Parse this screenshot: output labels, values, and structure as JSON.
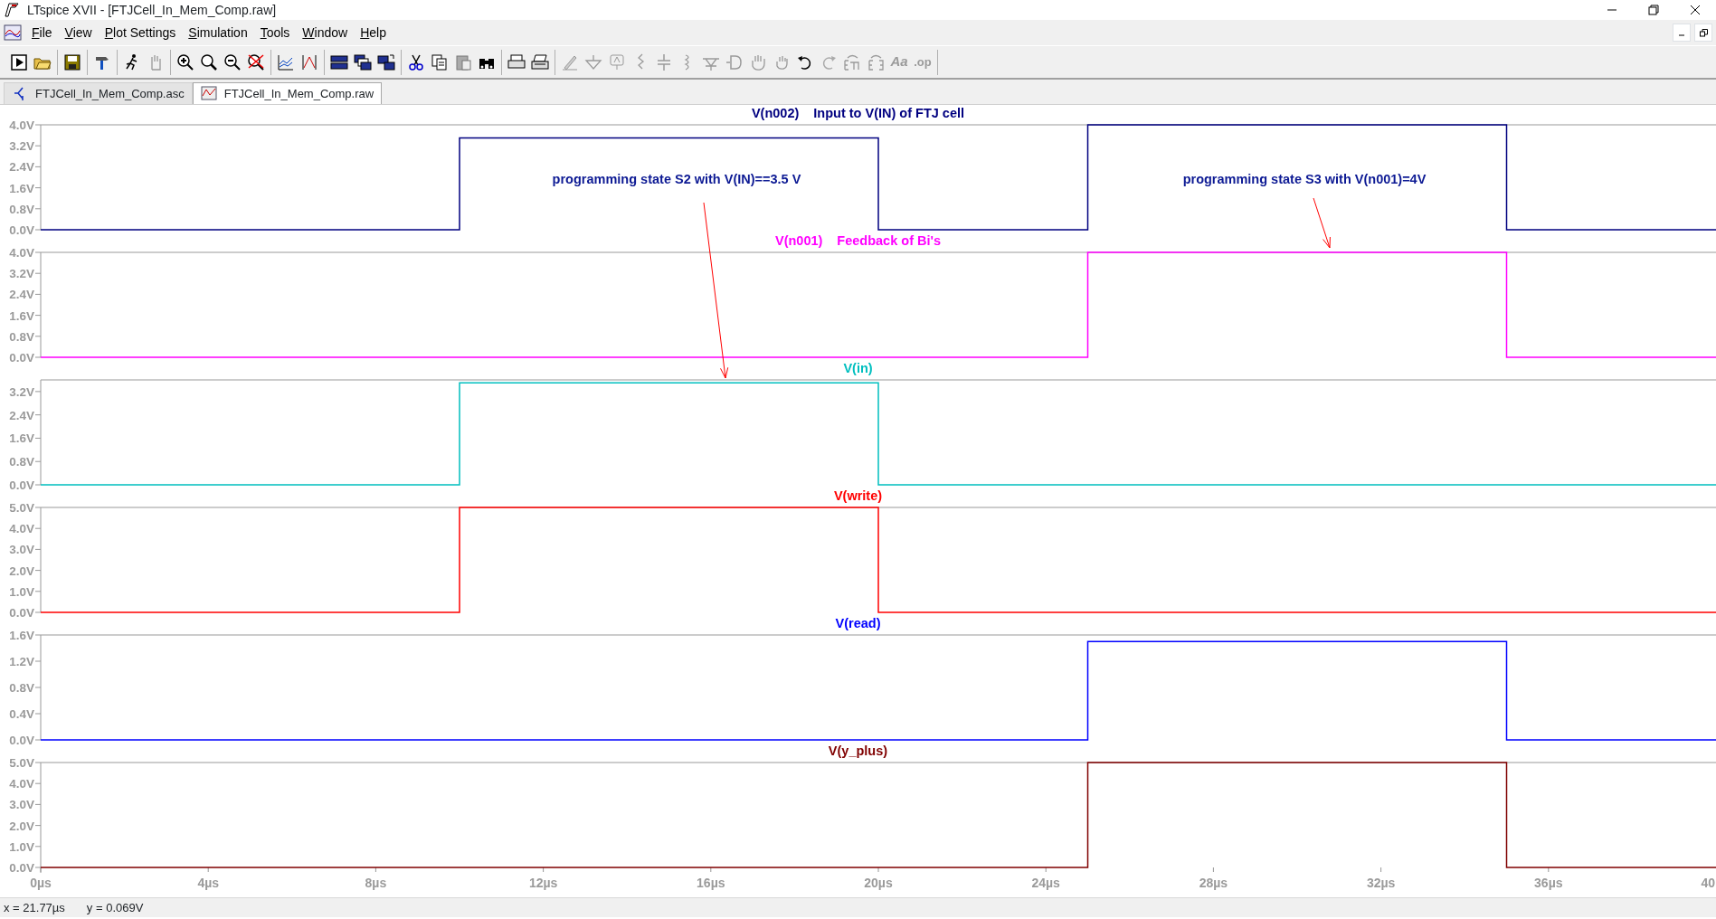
{
  "window": {
    "title": "LTspice XVII - [FTJCell_In_Mem_Comp.raw]"
  },
  "menu": [
    "File",
    "View",
    "Plot Settings",
    "Simulation",
    "Tools",
    "Window",
    "Help"
  ],
  "toolbar": {
    "text_buttons": [
      "Aa",
      ".op"
    ]
  },
  "tabs": [
    {
      "label": "FTJCell_In_Mem_Comp.asc",
      "kind": "schematic",
      "selected": false
    },
    {
      "label": "FTJCell_In_Mem_Comp.raw",
      "kind": "waveform",
      "selected": true
    }
  ],
  "panes": [
    {
      "description": "Input to V(IN) of FTJ cell",
      "chart_data": {
        "type": "line",
        "x": [
          0,
          10,
          10,
          20,
          20,
          25,
          25,
          35,
          35,
          40
        ],
        "xlim": [
          0,
          40
        ],
        "ylim": [
          0,
          4
        ],
        "series": [
          {
            "name": "V(n002)",
            "color": "#000080",
            "values": [
              0,
              0,
              3.5,
              3.5,
              0,
              0,
              4,
              4,
              0,
              0
            ]
          }
        ],
        "yticks": [
          {
            "value": 0,
            "label": "0.0V"
          },
          {
            "value": 0.8,
            "label": "0.8V"
          },
          {
            "value": 1.6,
            "label": "1.6V"
          },
          {
            "value": 2.4,
            "label": "2.4V"
          },
          {
            "value": 3.2,
            "label": "3.2V"
          },
          {
            "value": 4,
            "label": "4.0V"
          }
        ]
      }
    },
    {
      "description": "Feedback of Bi's",
      "chart_data": {
        "type": "line",
        "x": [
          0,
          10,
          10,
          20,
          20,
          25,
          25,
          35,
          35,
          40
        ],
        "xlim": [
          0,
          40
        ],
        "ylim": [
          0,
          4
        ],
        "series": [
          {
            "name": "V(n001)",
            "color": "#ff00ff",
            "values": [
              0,
              0,
              0,
              0,
              0,
              0,
              4,
              4,
              0,
              0
            ]
          }
        ],
        "yticks": [
          {
            "value": 0,
            "label": "0.0V"
          },
          {
            "value": 0.8,
            "label": "0.8V"
          },
          {
            "value": 1.6,
            "label": "1.6V"
          },
          {
            "value": 2.4,
            "label": "2.4V"
          },
          {
            "value": 3.2,
            "label": "3.2V"
          },
          {
            "value": 4,
            "label": "4.0V"
          }
        ]
      }
    },
    {
      "chart_data": {
        "type": "line",
        "x": [
          0,
          10,
          10,
          20,
          20,
          25,
          25,
          35,
          35,
          40
        ],
        "xlim": [
          0,
          40
        ],
        "ylim": [
          0,
          3.6
        ],
        "series": [
          {
            "name": "V(in)",
            "color": "#00bfbf",
            "values": [
              0,
              0,
              3.5,
              3.5,
              0,
              0,
              0,
              0,
              0,
              0
            ]
          }
        ],
        "yticks": [
          {
            "value": 0,
            "label": "0.0V"
          },
          {
            "value": 0.8,
            "label": "0.8V"
          },
          {
            "value": 1.6,
            "label": "1.6V"
          },
          {
            "value": 2.4,
            "label": "2.4V"
          },
          {
            "value": 3.2,
            "label": "3.2V"
          }
        ]
      }
    },
    {
      "chart_data": {
        "type": "line",
        "x": [
          0,
          10,
          10,
          20,
          20,
          25,
          25,
          35,
          35,
          40
        ],
        "xlim": [
          0,
          40
        ],
        "ylim": [
          0,
          5
        ],
        "series": [
          {
            "name": "V(write)",
            "color": "#ff0000",
            "values": [
              0,
              0,
              5,
              5,
              0,
              0,
              0,
              0,
              0,
              0
            ]
          }
        ],
        "yticks": [
          {
            "value": 0,
            "label": "0.0V"
          },
          {
            "value": 1,
            "label": "1.0V"
          },
          {
            "value": 2,
            "label": "2.0V"
          },
          {
            "value": 3,
            "label": "3.0V"
          },
          {
            "value": 4,
            "label": "4.0V"
          },
          {
            "value": 5,
            "label": "5.0V"
          }
        ]
      }
    },
    {
      "chart_data": {
        "type": "line",
        "x": [
          0,
          10,
          10,
          20,
          20,
          25,
          25,
          35,
          35,
          40
        ],
        "xlim": [
          0,
          40
        ],
        "ylim": [
          0,
          1.6
        ],
        "series": [
          {
            "name": "V(read)",
            "color": "#0000ff",
            "values": [
              0,
              0,
              0,
              0,
              0,
              0,
              1.5,
              1.5,
              0,
              0
            ]
          }
        ],
        "yticks": [
          {
            "value": 0,
            "label": "0.0V"
          },
          {
            "value": 0.4,
            "label": "0.4V"
          },
          {
            "value": 0.8,
            "label": "0.8V"
          },
          {
            "value": 1.2,
            "label": "1.2V"
          },
          {
            "value": 1.6,
            "label": "1.6V"
          }
        ]
      }
    },
    {
      "chart_data": {
        "type": "line",
        "x": [
          0,
          10,
          10,
          20,
          20,
          25,
          25,
          35,
          35,
          40
        ],
        "xlim": [
          0,
          40
        ],
        "ylim": [
          0,
          5
        ],
        "series": [
          {
            "name": "V(y_plus)",
            "color": "#800000",
            "values": [
              0,
              0,
              0,
              0,
              0,
              0,
              5,
              5,
              0,
              0
            ]
          }
        ],
        "yticks": [
          {
            "value": 0,
            "label": "0.0V"
          },
          {
            "value": 1,
            "label": "1.0V"
          },
          {
            "value": 2,
            "label": "2.0V"
          },
          {
            "value": 3,
            "label": "3.0V"
          },
          {
            "value": 4,
            "label": "4.0V"
          },
          {
            "value": 5,
            "label": "5.0V"
          }
        ],
        "xticks": [
          {
            "value": 0,
            "label": "0µs"
          },
          {
            "value": 4,
            "label": "4µs"
          },
          {
            "value": 8,
            "label": "8µs"
          },
          {
            "value": 12,
            "label": "12µs"
          },
          {
            "value": 16,
            "label": "16µs"
          },
          {
            "value": 20,
            "label": "20µs"
          },
          {
            "value": 24,
            "label": "24µs"
          },
          {
            "value": 28,
            "label": "28µs"
          },
          {
            "value": 32,
            "label": "32µs"
          },
          {
            "value": 36,
            "label": "36µs"
          },
          {
            "value": 40,
            "label": "40"
          }
        ]
      }
    }
  ],
  "annotations": [
    {
      "text": "programming state S2 with V(IN)==3.5 V"
    },
    {
      "text": "programming state S3 with V(n001)=4V"
    }
  ],
  "status_bar": {
    "x": "x = 21.77µs",
    "y": "y = 0.069V"
  }
}
